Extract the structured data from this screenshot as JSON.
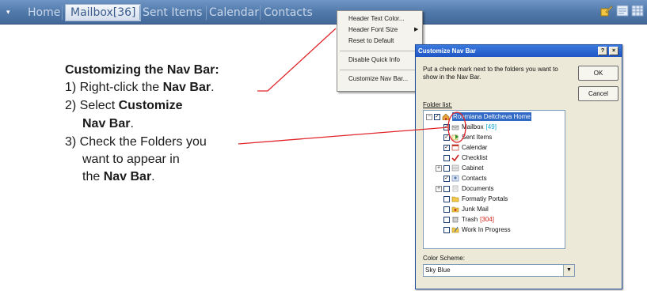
{
  "nav_bar": {
    "arrow_glyph": "▾",
    "tabs": [
      {
        "label": "Home",
        "active": false
      },
      {
        "label": "Mailbox[36]",
        "active": true
      },
      {
        "label": "Sent Items",
        "active": false
      },
      {
        "label": "Calendar",
        "active": false
      },
      {
        "label": "Contacts",
        "active": false
      }
    ],
    "icons": [
      "pencil-icon",
      "notes-icon",
      "grid-icon"
    ],
    "colors": {
      "bar": "#4f77a8",
      "active_tab_text": "#3b5d8e",
      "inactive_tab_text": "#c9d7ea"
    }
  },
  "context_menu": {
    "items": [
      {
        "label": "Header Text Color...",
        "submenu": false
      },
      {
        "label": "Header Font Size",
        "submenu": true
      },
      {
        "label": "Reset to Default",
        "submenu": false
      },
      {
        "label": "Disable Quick Info",
        "submenu": false
      },
      {
        "label": "Customize Nav Bar...",
        "submenu": false
      }
    ]
  },
  "instructions": {
    "title": "Customizing the Nav Bar:",
    "step1_prefix": "1) Right-click the ",
    "step1_bold": "Nav Bar",
    "step1_suffix": ".",
    "step2_prefix": "2) Select ",
    "step2_bold_a": "Customize",
    "step2_bold_b": "Nav Bar",
    "step2_suffix": ".",
    "step3_line1": "3) Check the Folders you",
    "step3_line2": "want to appear in",
    "step3_line3_prefix": "the ",
    "step3_line3_bold": "Nav Bar",
    "step3_line3_suffix": "."
  },
  "dialog": {
    "title": "Customize Nav Bar",
    "help_glyph": "?",
    "close_glyph": "×",
    "description_line1": "Put a check mark next to the folders you want to",
    "description_line2": "show in the Nav Bar.",
    "ok_label": "OK",
    "cancel_label": "Cancel",
    "folder_list_label": "Folder list:",
    "folders": [
      {
        "label": "Roumiana Deltcheva Home",
        "checked": true,
        "expander": "−",
        "count": "",
        "icon": "home-icon",
        "selected": true
      },
      {
        "label": "Mailbox",
        "checked": true,
        "expander": "",
        "count": "[49]",
        "icon": "mailbox-icon"
      },
      {
        "label": "Sent Items",
        "checked": true,
        "expander": "",
        "count": "",
        "icon": "sent-items-icon"
      },
      {
        "label": "Calendar",
        "checked": true,
        "expander": "",
        "count": "",
        "icon": "calendar-icon"
      },
      {
        "label": "Checklist",
        "checked": false,
        "expander": "",
        "count": "",
        "icon": "checklist-icon"
      },
      {
        "label": "Cabinet",
        "checked": false,
        "expander": "+",
        "count": "",
        "icon": "cabinet-icon"
      },
      {
        "label": "Contacts",
        "checked": true,
        "expander": "",
        "count": "",
        "icon": "contacts-icon"
      },
      {
        "label": "Documents",
        "checked": false,
        "expander": "+",
        "count": "",
        "icon": "documents-icon"
      },
      {
        "label": "Formatiy Portals",
        "checked": false,
        "expander": "",
        "count": "",
        "icon": "folder-icon"
      },
      {
        "label": "Junk Mail",
        "checked": false,
        "expander": "",
        "count": "",
        "icon": "junk-mail-icon"
      },
      {
        "label": "Trash",
        "checked": false,
        "expander": "",
        "count": "[304]",
        "icon": "trash-icon"
      },
      {
        "label": "Work In Progress",
        "checked": false,
        "expander": "",
        "count": "",
        "icon": "work-in-progress-icon"
      }
    ],
    "color_scheme_label": "Color Scheme:",
    "color_scheme_value": "Sky Blue",
    "colors": {
      "title_bar": "#1e56c5",
      "mailbox_count": "#14a6d8",
      "trash_count": "#d0201b"
    }
  },
  "callout_color": "#e0242a"
}
